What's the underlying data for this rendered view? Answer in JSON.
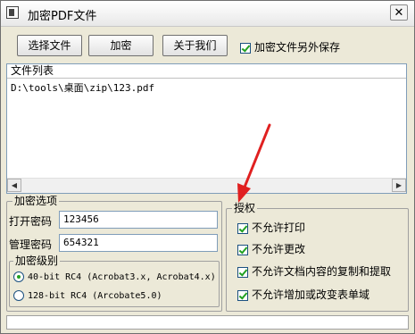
{
  "window": {
    "title": "加密PDF文件",
    "close_glyph": "✕"
  },
  "toolbar": {
    "select_label": "选择文件",
    "encrypt_label": "加密",
    "about_label": "关于我们",
    "save_separately_label": "加密文件另外保存",
    "save_separately_checked": true
  },
  "file_list": {
    "header": "文件列表",
    "rows": [
      "D:\\tools\\桌面\\zip\\123.pdf"
    ]
  },
  "encrypt_options": {
    "title": "加密选项",
    "open_password_label": "打开密码",
    "open_password_value": "123456",
    "admin_password_label": "管理密码",
    "admin_password_value": "654321",
    "level_title": "加密级别",
    "levels": [
      {
        "label": "40-bit RC4 (Acrobat3.x, Acrobat4.x)",
        "selected": true
      },
      {
        "label": "128-bit RC4 (Arcobate5.0)",
        "selected": false
      }
    ]
  },
  "permissions": {
    "title": "授权",
    "items": [
      {
        "label": "不允许打印",
        "checked": true
      },
      {
        "label": "不允许更改",
        "checked": true
      },
      {
        "label": "不允许文档内容的复制和提取",
        "checked": true
      },
      {
        "label": "不允许增加或改变表单域",
        "checked": true
      }
    ]
  },
  "colors": {
    "accent_check": "#21a121",
    "annotation_arrow": "#e02020"
  }
}
